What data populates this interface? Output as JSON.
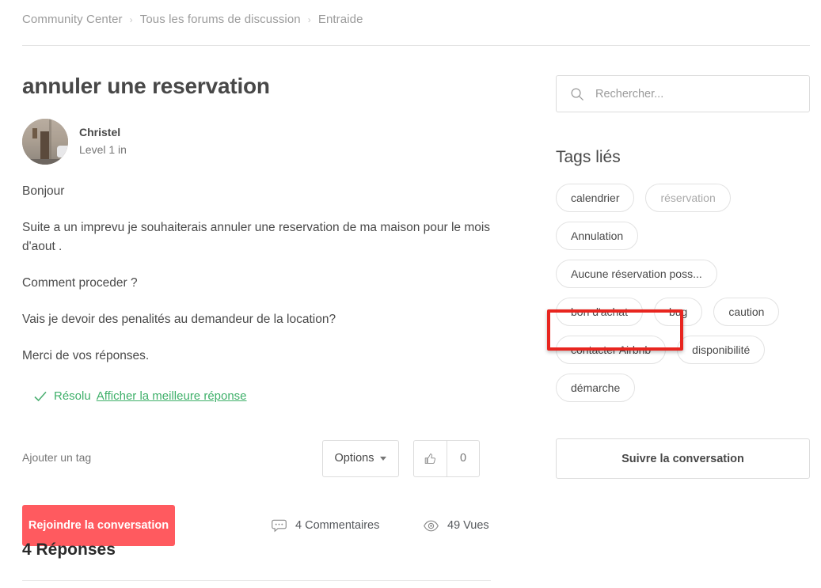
{
  "breadcrumb": {
    "separator": "›",
    "items": [
      {
        "label": "Community Center"
      },
      {
        "label": "Tous les forums de discussion"
      },
      {
        "label": "Entraide"
      }
    ]
  },
  "post": {
    "title": "annuler une reservation",
    "author": {
      "name": "Christel",
      "level": "Level 1 in",
      "avatar_icon": "user-avatar-photo"
    },
    "paragraphs": [
      "Bonjour",
      "Suite a un imprevu je souhaiterais annuler une reservation de ma maison pour le mois d'aout .",
      "Comment proceder ?",
      "Vais je devoir des penalités au demandeur de la location?",
      "Merci de vos réponses."
    ],
    "resolved": {
      "check_icon": "check-icon",
      "label": "Résolu",
      "link_label": "Afficher la meilleure réponse",
      "color": "#3fb06a"
    },
    "actions": {
      "add_tag_label": "Ajouter un tag",
      "options_label": "Options",
      "options_caret_icon": "chevron-down-icon",
      "like_icon": "thumbs-up-icon",
      "like_count": "0"
    },
    "cta": {
      "join_label": "Rejoindre la conversation",
      "join_color": "#ff5a5f"
    },
    "stats": [
      {
        "icon": "comment-bubble-icon",
        "label": "4 Commentaires"
      },
      {
        "icon": "eye-icon",
        "label": "49 Vues"
      }
    ]
  },
  "replies": {
    "heading": "4 Réponses"
  },
  "sidebar": {
    "search": {
      "icon": "search-icon",
      "placeholder": "Rechercher...",
      "value": ""
    },
    "tags_heading": "Tags liés",
    "tags": [
      {
        "label": "calendrier",
        "muted": false
      },
      {
        "label": "réservation",
        "muted": true
      },
      {
        "label": "Annulation",
        "muted": false
      },
      {
        "label": "Aucune réservation poss...",
        "muted": false
      },
      {
        "label": "bon d'achat",
        "muted": false
      },
      {
        "label": "bug",
        "muted": false
      },
      {
        "label": "caution",
        "muted": false
      },
      {
        "label": "contacter Airbnb",
        "muted": false
      },
      {
        "label": "disponibilité",
        "muted": false
      },
      {
        "label": "démarche",
        "muted": false
      }
    ],
    "follow_label": "Suivre la conversation"
  },
  "annotation": {
    "target": "contacter Airbnb",
    "color": "#e8251f"
  }
}
